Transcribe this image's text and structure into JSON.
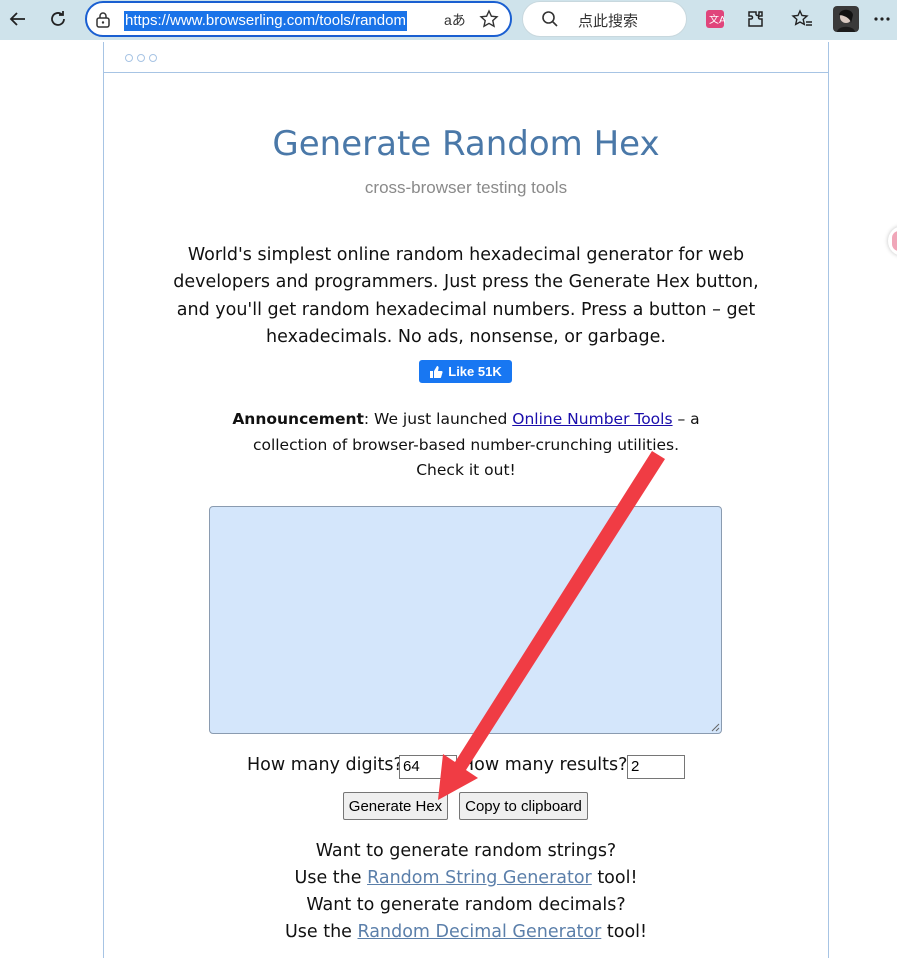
{
  "browser": {
    "url": "https://www.browserling.com/tools/random",
    "reader_mode_label": "aあ",
    "search_placeholder": "点此搜索"
  },
  "page": {
    "title": "Generate Random Hex",
    "subtitle": "cross-browser testing tools",
    "intro": "World's simplest online random hexadecimal generator for web developers and programmers. Just press the Generate Hex button, and you'll get random hexadecimal numbers. Press a button – get hexadecimals. No ads, nonsense, or garbage.",
    "like_label": "Like 51K",
    "announcement": {
      "label": "Announcement",
      "text_before": ": We just launched ",
      "link": "Online Number Tools",
      "text_after": " – a collection of browser-based number-crunching utilities. Check it out!"
    },
    "output_value": "",
    "digits_label": "How many digits?",
    "digits_value": "64",
    "results_label": "How many results?",
    "results_value": "2",
    "generate_button": "Generate Hex",
    "copy_button": "Copy to clipboard",
    "more": {
      "line1": "Want to generate random strings?",
      "line2_before": "Use the ",
      "line2_link": "Random String Generator",
      "line2_after": " tool!",
      "line3": "Want to generate random decimals?",
      "line4_before": "Use the ",
      "line4_link": "Random Decimal Generator",
      "line4_after": " tool!"
    }
  },
  "colors": {
    "accent": "#1a73e8",
    "title": "#4a78a8",
    "annotation_arrow": "#f03c44",
    "output_bg": "#d4e6fb"
  },
  "icons": {
    "back": "arrow-left-icon",
    "refresh": "refresh-icon",
    "lock": "lock-icon",
    "favorite": "star-icon",
    "search": "search-icon",
    "translate": "translate-icon",
    "extensions": "puzzle-icon",
    "favorites": "favorites-icon",
    "profile": "avatar",
    "more": "more-icon"
  }
}
